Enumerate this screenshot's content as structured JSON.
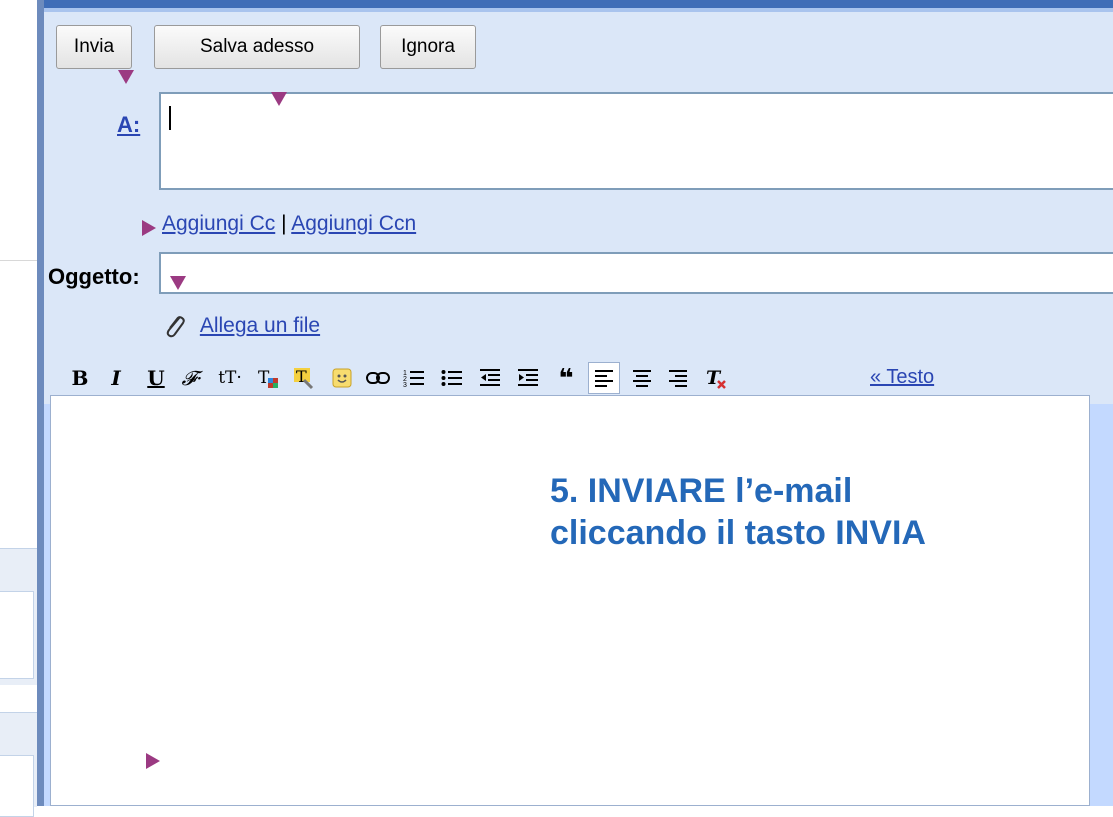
{
  "toolbar": {
    "send_label": "Invia",
    "save_label": "Salva adesso",
    "discard_label": "Ignora"
  },
  "recipients": {
    "to_label": "A:",
    "to_value": "",
    "add_cc_label": "Aggiungi Cc",
    "separator": "|",
    "add_bcc_label": "Aggiungi Ccn"
  },
  "subject": {
    "label": "Oggetto:",
    "value": ""
  },
  "attach": {
    "label": "Allega un file",
    "icon": "paperclip-icon"
  },
  "formatting": {
    "buttons": [
      {
        "name": "bold-icon",
        "glyph": "B"
      },
      {
        "name": "italic-icon",
        "glyph": "I"
      },
      {
        "name": "underline-icon",
        "glyph": "U"
      },
      {
        "name": "font-icon",
        "glyph": "𝓕·"
      },
      {
        "name": "font-size-icon",
        "glyph": "tT·"
      },
      {
        "name": "text-color-icon",
        "glyph": "T"
      },
      {
        "name": "highlight-icon",
        "glyph": "T"
      },
      {
        "name": "emoticon-icon",
        "glyph": "☺"
      },
      {
        "name": "link-icon",
        "glyph": "⊖"
      },
      {
        "name": "numbered-list-icon",
        "glyph": "≡"
      },
      {
        "name": "bulleted-list-icon",
        "glyph": "≡"
      },
      {
        "name": "decrease-indent-icon",
        "glyph": "⇤"
      },
      {
        "name": "increase-indent-icon",
        "glyph": "⇥"
      },
      {
        "name": "quote-icon",
        "glyph": "❝"
      },
      {
        "name": "align-left-icon",
        "glyph": "≡"
      },
      {
        "name": "align-center-icon",
        "glyph": "≡"
      },
      {
        "name": "align-right-icon",
        "glyph": "≡"
      },
      {
        "name": "remove-formatting-icon",
        "glyph": "T"
      }
    ],
    "plain_text_link": "« Testo"
  },
  "body": {
    "value": ""
  },
  "instruction": {
    "line1": "5. INVIARE l’e-mail",
    "line2": "cliccando il tasto INVIA"
  },
  "colors": {
    "accent_blue": "#3f6db7",
    "pane_blue": "#c3d9ff",
    "link_blue": "#2a46b3",
    "instruction_blue": "#2468b8",
    "marker_purple": "#9b3a82"
  }
}
